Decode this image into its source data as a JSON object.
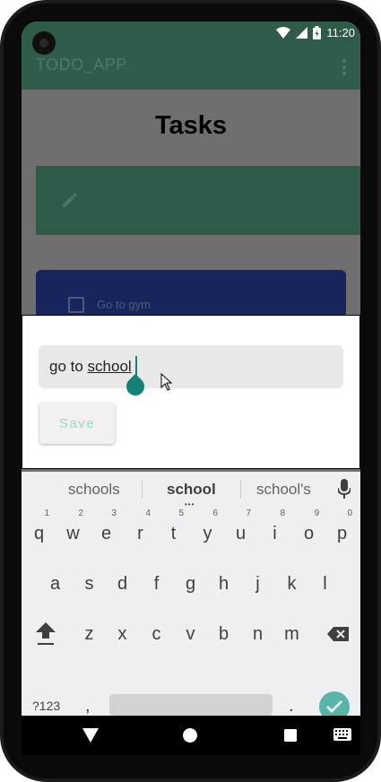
{
  "status_bar": {
    "time": "11:20"
  },
  "app_bar": {
    "title": "TODO_APP"
  },
  "page": {
    "heading": "Tasks"
  },
  "tasks": [
    {
      "label": "Go to gym",
      "checked": false
    }
  ],
  "dialog": {
    "input_prefix": "go to ",
    "input_composing": "school",
    "save_label": "Save"
  },
  "keyboard": {
    "suggestions": [
      "schools",
      "school",
      "school's"
    ],
    "row1": [
      {
        "key": "q",
        "num": "1"
      },
      {
        "key": "w",
        "num": "2"
      },
      {
        "key": "e",
        "num": "3"
      },
      {
        "key": "r",
        "num": "4"
      },
      {
        "key": "t",
        "num": "5"
      },
      {
        "key": "y",
        "num": "6"
      },
      {
        "key": "u",
        "num": "7"
      },
      {
        "key": "i",
        "num": "8"
      },
      {
        "key": "o",
        "num": "9"
      },
      {
        "key": "p",
        "num": "0"
      }
    ],
    "row2": [
      "a",
      "s",
      "d",
      "f",
      "g",
      "h",
      "j",
      "k",
      "l"
    ],
    "row3": [
      "z",
      "x",
      "c",
      "v",
      "b",
      "n",
      "m"
    ],
    "symbols_label": "?123",
    "comma": ",",
    "period": "."
  },
  "colors": {
    "app_bar": "#2f5d49",
    "accent": "#118377",
    "task_card": "#17255c",
    "enter_key": "#57b5aa"
  },
  "icons": [
    "wifi-icon",
    "cell-signal-icon",
    "battery-icon",
    "overflow-menu-icon",
    "pencil-icon",
    "checkbox-icon",
    "mouse-cursor-icon",
    "mic-icon",
    "shift-icon",
    "backspace-icon",
    "enter-check-icon",
    "nav-back-icon",
    "nav-home-icon",
    "nav-recents-icon",
    "keyboard-switch-icon"
  ]
}
